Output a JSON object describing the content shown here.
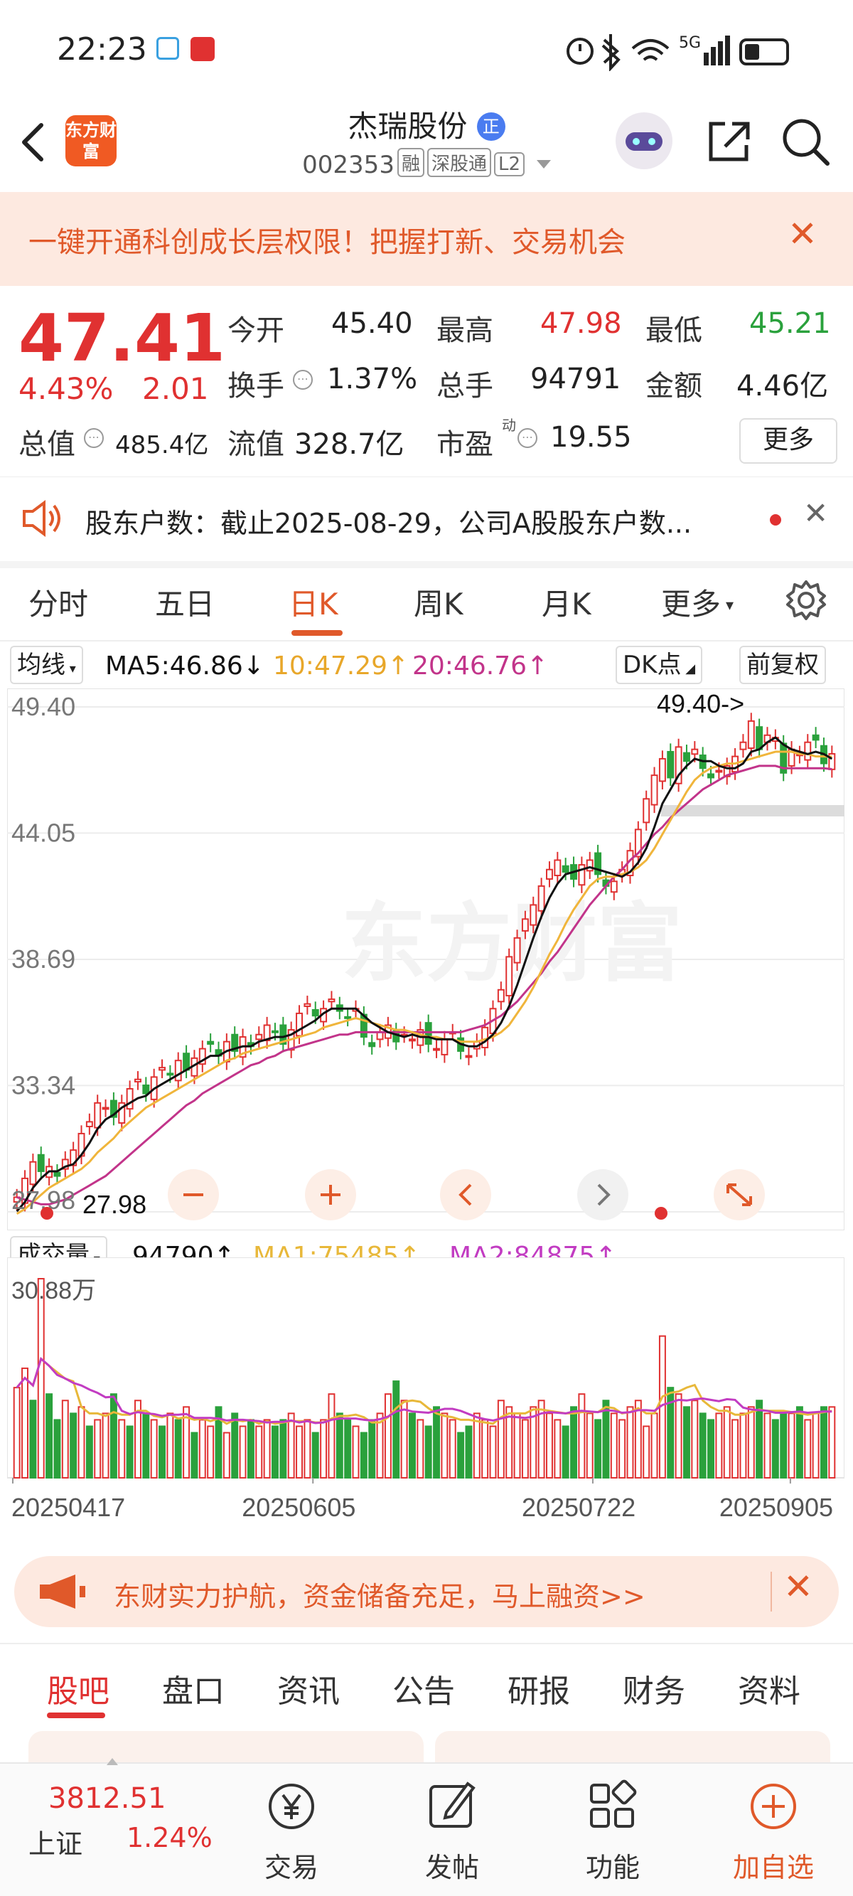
{
  "status": {
    "time": "22:23",
    "network": "5G"
  },
  "header": {
    "logo_text": "东方财富",
    "name": "杰瑞股份",
    "badge": "正",
    "code": "002353",
    "tags": [
      "融",
      "深股通",
      "L2"
    ]
  },
  "banner": {
    "text": "一键开通科创成长层权限！把握打新、交易机会"
  },
  "quote": {
    "price": "47.41",
    "change_pct": "4.43%",
    "change_amt": "2.01",
    "open_label": "今开",
    "open": "45.40",
    "high_label": "最高",
    "high": "47.98",
    "low_label": "最低",
    "low": "45.21",
    "turnover_label": "换手",
    "turnover": "1.37%",
    "volume_label": "总手",
    "volume": "94791",
    "amount_label": "金额",
    "amount": "4.46亿",
    "mcap_label": "总值",
    "mcap": "485.4亿",
    "float_label": "流值",
    "float": "328.7亿",
    "pe_label": "市盈",
    "pe_sup": "动",
    "pe": "19.55",
    "more": "更多"
  },
  "notice": {
    "text": "股东户数：截止2025-08-29，公司A股股东户数..."
  },
  "ktabs": {
    "items": [
      "分时",
      "五日",
      "日K",
      "周K",
      "月K",
      "更多"
    ],
    "active": "日K"
  },
  "ma_row": {
    "type_btn": "均线",
    "ma5": "MA5:46.86↓",
    "ma10": "10:47.29↑",
    "ma20": "20:46.76↑",
    "dk_btn": "DK点",
    "adj_btn": "前复权"
  },
  "colors": {
    "up": "#e03131",
    "down": "#2aa13c",
    "ma5": "#111111",
    "ma10": "#f0b53b",
    "ma20": "#c2348a",
    "brand": "#e0592a"
  },
  "chart_data": {
    "type": "candlestick",
    "y_ticks": [
      "49.40",
      "44.05",
      "38.69",
      "33.34",
      "27.98"
    ],
    "ylim": [
      27.98,
      49.4
    ],
    "annotations": [
      "49.40->",
      "27.98"
    ],
    "x_ticks": [
      "20250417",
      "20250605",
      "20250722",
      "20250905"
    ],
    "close": [
      28.6,
      29.4,
      30.1,
      29.7,
      29.9,
      29.5,
      30.2,
      30.6,
      31.3,
      31.8,
      32.6,
      32.4,
      32.0,
      32.6,
      33.2,
      33.6,
      33.0,
      33.7,
      34.1,
      33.8,
      34.4,
      34.0,
      34.5,
      34.9,
      35.1,
      34.6,
      35.2,
      34.8,
      35.4,
      35.0,
      35.5,
      35.9,
      35.6,
      35.1,
      35.7,
      36.4,
      36.8,
      36.3,
      36.6,
      37.0,
      36.5,
      36.2,
      36.6,
      35.4,
      35.0,
      35.6,
      35.9,
      35.2,
      35.5,
      35.3,
      35.7,
      35.1,
      34.9,
      35.3,
      35.6,
      34.8,
      34.6,
      35.2,
      35.8,
      36.6,
      37.4,
      38.8,
      39.6,
      40.4,
      41.0,
      41.8,
      42.5,
      42.9,
      42.4,
      42.1,
      42.7,
      42.9,
      42.3,
      41.8,
      42.0,
      42.5,
      43.3,
      44.2,
      45.5,
      46.5,
      47.2,
      46.4,
      47.7,
      47.1,
      47.6,
      46.8,
      46.4,
      46.7,
      46.9,
      47.3,
      47.9,
      48.8,
      47.6,
      48.2,
      48.1,
      46.6,
      47.6,
      47.4,
      47.9,
      48.0,
      47.0,
      47.41
    ],
    "ma5": [
      28.0,
      28.4,
      29.0,
      29.4,
      29.7,
      29.7,
      29.9,
      30.0,
      30.4,
      30.9,
      31.5,
      31.9,
      32.1,
      32.4,
      32.6,
      32.8,
      32.9,
      33.2,
      33.4,
      33.6,
      33.8,
      34.0,
      34.2,
      34.4,
      34.6,
      34.6,
      34.8,
      34.9,
      35.0,
      35.0,
      35.2,
      35.3,
      35.4,
      35.4,
      35.5,
      35.7,
      35.9,
      36.1,
      36.4,
      36.6,
      36.6,
      36.6,
      36.6,
      36.3,
      36.0,
      35.8,
      35.6,
      35.5,
      35.4,
      35.5,
      35.4,
      35.4,
      35.3,
      35.3,
      35.3,
      35.1,
      35.0,
      35.0,
      35.2,
      35.5,
      36.0,
      36.7,
      37.6,
      38.6,
      39.6,
      40.5,
      41.3,
      41.9,
      42.3,
      42.4,
      42.5,
      42.6,
      42.5,
      42.4,
      42.3,
      42.2,
      42.4,
      42.8,
      43.4,
      44.3,
      45.3,
      45.9,
      46.5,
      46.9,
      47.2,
      47.1,
      47.1,
      46.9,
      46.8,
      46.8,
      47.0,
      47.5,
      47.6,
      47.9,
      48.1,
      47.8,
      47.6,
      47.5,
      47.4,
      47.5,
      47.4,
      47.2
    ],
    "ma10": [
      27.9,
      28.1,
      28.4,
      28.7,
      29.0,
      29.2,
      29.4,
      29.6,
      29.8,
      30.1,
      30.5,
      30.8,
      31.1,
      31.5,
      31.8,
      32.1,
      32.4,
      32.6,
      32.8,
      33.0,
      33.2,
      33.4,
      33.6,
      33.8,
      34.0,
      34.2,
      34.4,
      34.5,
      34.7,
      34.8,
      34.9,
      35.0,
      35.1,
      35.2,
      35.3,
      35.4,
      35.5,
      35.6,
      35.8,
      35.9,
      36.0,
      36.1,
      36.2,
      36.1,
      36.0,
      35.9,
      35.8,
      35.7,
      35.7,
      35.6,
      35.5,
      35.4,
      35.4,
      35.3,
      35.3,
      35.2,
      35.2,
      35.2,
      35.3,
      35.4,
      35.6,
      35.9,
      36.4,
      36.9,
      37.5,
      38.2,
      38.9,
      39.5,
      40.2,
      40.8,
      41.3,
      41.8,
      42.1,
      42.2,
      42.2,
      42.3,
      42.4,
      42.6,
      42.9,
      43.4,
      44.0,
      44.6,
      45.2,
      45.8,
      46.3,
      46.6,
      46.8,
      46.9,
      47.0,
      47.0,
      47.1,
      47.2,
      47.3,
      47.4,
      47.5,
      47.5,
      47.5,
      47.4,
      47.4,
      47.3,
      47.3,
      47.29
    ],
    "ma20": [
      28.6,
      28.5,
      28.4,
      28.3,
      28.3,
      28.4,
      28.5,
      28.7,
      28.9,
      29.1,
      29.3,
      29.5,
      29.8,
      30.1,
      30.4,
      30.7,
      31.0,
      31.3,
      31.6,
      31.9,
      32.2,
      32.5,
      32.7,
      33.0,
      33.2,
      33.4,
      33.6,
      33.8,
      34.0,
      34.2,
      34.3,
      34.5,
      34.6,
      34.8,
      34.9,
      35.0,
      35.1,
      35.2,
      35.3,
      35.4,
      35.5,
      35.5,
      35.6,
      35.6,
      35.6,
      35.6,
      35.6,
      35.6,
      35.6,
      35.6,
      35.6,
      35.6,
      35.6,
      35.6,
      35.6,
      35.6,
      35.7,
      35.8,
      35.9,
      36.1,
      36.3,
      36.6,
      36.9,
      37.3,
      37.7,
      38.1,
      38.6,
      39.0,
      39.5,
      40.0,
      40.5,
      41.0,
      41.4,
      41.8,
      42.2,
      42.5,
      42.9,
      43.2,
      43.6,
      44.0,
      44.3,
      44.7,
      45.0,
      45.3,
      45.6,
      45.9,
      46.1,
      46.3,
      46.5,
      46.6,
      46.7,
      46.8,
      46.9,
      46.9,
      46.9,
      46.8,
      46.8,
      46.8,
      46.8,
      46.8,
      46.8,
      46.76
    ]
  },
  "volume": {
    "label": "成交量",
    "value": "94790↑",
    "ma1": "MA1:75485↑",
    "ma2": "MA2:84875↑",
    "max_label": "30.88万",
    "values": [
      14,
      17,
      12,
      30.9,
      13,
      9,
      12,
      10,
      11,
      8,
      9,
      10,
      13,
      9,
      8,
      12,
      10,
      9,
      8,
      10,
      9,
      11,
      7,
      9,
      8,
      11,
      7,
      10,
      8,
      9,
      8,
      9,
      8,
      9,
      10,
      8,
      9,
      7,
      9,
      13,
      10,
      9,
      8,
      7,
      9,
      10,
      13,
      15,
      12,
      10,
      9,
      8,
      11,
      10,
      9,
      7,
      8,
      10,
      9,
      8,
      12,
      11,
      10,
      9,
      11,
      12,
      10,
      9,
      8,
      11,
      13,
      10,
      9,
      12,
      10,
      9,
      11,
      12,
      8,
      10,
      22,
      14,
      13,
      11,
      12,
      10,
      9,
      10,
      11,
      9,
      10,
      11,
      12,
      10,
      9,
      10,
      10,
      11,
      9,
      10,
      11,
      11
    ],
    "up": [
      1,
      1,
      0,
      1,
      0,
      0,
      1,
      0,
      1,
      0,
      1,
      1,
      0,
      1,
      0,
      1,
      0,
      1,
      0,
      1,
      0,
      1,
      0,
      1,
      1,
      0,
      1,
      0,
      1,
      0,
      1,
      1,
      0,
      0,
      1,
      1,
      1,
      0,
      1,
      1,
      0,
      0,
      1,
      0,
      0,
      1,
      1,
      0,
      1,
      0,
      1,
      0,
      0,
      1,
      1,
      0,
      0,
      1,
      1,
      1,
      1,
      1,
      1,
      1,
      1,
      1,
      1,
      1,
      0,
      0,
      1,
      1,
      0,
      0,
      1,
      1,
      1,
      1,
      1,
      1,
      1,
      0,
      1,
      0,
      1,
      0,
      0,
      1,
      1,
      1,
      1,
      1,
      0,
      1,
      0,
      0,
      1,
      0,
      1,
      1,
      0,
      1
    ]
  },
  "promo": {
    "text": "东财实力护航，资金储备充足，马上融资>>"
  },
  "bottom_tabs": {
    "items": [
      "股吧",
      "盘口",
      "资讯",
      "公告",
      "研报",
      "财务",
      "资料"
    ],
    "active": "股吧"
  },
  "bottom_nav": {
    "index_value": "3812.51",
    "index_name": "上证",
    "index_change": "1.24%",
    "trade": "交易",
    "post": "发帖",
    "func": "功能",
    "add": "加自选"
  }
}
